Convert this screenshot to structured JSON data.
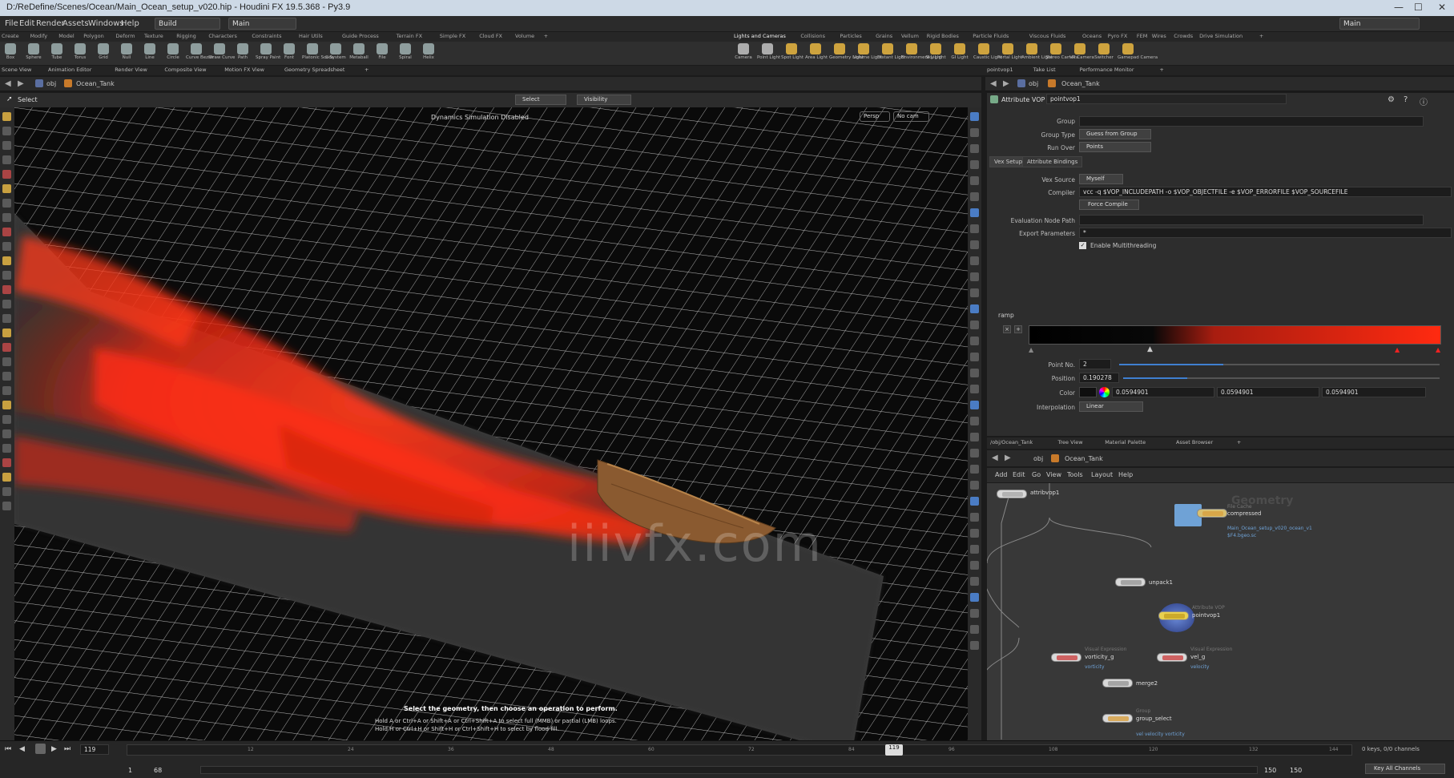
{
  "window": {
    "title": "D:/ReDefine/Scenes/Ocean/Main_Ocean_setup_v020.hip - Houdini FX 19.5.368 - Py3.9",
    "desktop_label": "Main",
    "controls": [
      "—",
      "☐",
      "✕"
    ]
  },
  "menubar": {
    "items": [
      "File",
      "Edit",
      "Render",
      "Assets",
      "Windows",
      "Help"
    ],
    "build_label": "Build",
    "main_label": "Main"
  },
  "shelf_tabs_left": [
    "Create",
    "Modify",
    "Model",
    "Polygon",
    "Deform",
    "Texture",
    "Rigging",
    "Characters",
    "Constraints",
    "Hair Utils",
    "Guide Process",
    "Terrain FX",
    "Simple FX",
    "Cloud FX",
    "Volume",
    "+"
  ],
  "shelf_tabs_right": [
    "Lights and Cameras",
    "Collisions",
    "Particles",
    "Grains",
    "Vellum",
    "Rigid Bodies",
    "Particle Fluids",
    "Viscous Fluids",
    "Oceans",
    "Pyro FX",
    "FEM",
    "Wires",
    "Crowds",
    "Drive Simulation",
    "+"
  ],
  "shelf_tools_left": [
    "Box",
    "Sphere",
    "Tube",
    "Torus",
    "Grid",
    "Null",
    "Line",
    "Circle",
    "Curve Bezier",
    "Draw Curve",
    "Path",
    "Spray Paint",
    "Font",
    "Platonic Solids",
    "L-System",
    "Metaball",
    "File",
    "Spiral",
    "Helix"
  ],
  "shelf_tools_right": [
    "Camera",
    "Point Light",
    "Spot Light",
    "Area Light",
    "Geometry Light",
    "Volume Light",
    "Distant Light",
    "Environment Light",
    "Sky Light",
    "GI Light",
    "Caustic Light",
    "Portal Light",
    "Ambient Light",
    "Stereo Camera",
    "VR Camera",
    "Switcher",
    "Gamepad Camera"
  ],
  "pane_tabs_left": [
    "Scene View",
    "Animation Editor",
    "Render View",
    "Composite View",
    "Motion FX View",
    "Geometry Spreadsheet",
    "+"
  ],
  "pane_tabs_right": [
    "pointvop1",
    "Take List",
    "Performance Monitor",
    "+"
  ],
  "viewport": {
    "path_root": "obj",
    "path_node": "Ocean_Tank",
    "tool_label": "Select",
    "select_dd": "Select",
    "visibility_dd": "Visibility",
    "status_top": "Dynamics Simulation Disabled",
    "persp": "Persp",
    "cam": "No cam",
    "hint_main": "Select the geometry, then choose an operation to perform.",
    "hint_1": "Hold A or Ctrl+A or Shift+A or Ctrl+Shift+A to select full (MMB) or partial (LMB) loops.",
    "hint_2": "Hold H or Ctrl+H or Shift+H or Ctrl+Shift+H to select by flood fill.",
    "watermark": "iiivfx.com"
  },
  "timeline": {
    "current_frame": "119",
    "start": "1",
    "end_field": "68",
    "range_end_a": "150",
    "range_end_b": "150",
    "marker": "119",
    "keys_info": "0 keys, 0/0 channels",
    "key_all": "Key All Channels",
    "ticks": [
      "12",
      "24",
      "36",
      "48",
      "60",
      "72",
      "84",
      "96",
      "108",
      "120",
      "132",
      "144"
    ]
  },
  "params": {
    "path_root": "obj",
    "path_node": "Ocean_Tank",
    "node_type": "Attribute VOP",
    "node_name": "pointvop1",
    "group_label": "Group",
    "group_value": "",
    "group_type_label": "Group Type",
    "group_type_value": "Guess from Group",
    "run_over_label": "Run Over",
    "run_over_value": "Points",
    "tab_vex": "Vex Setup",
    "tab_bind": "Attribute Bindings",
    "vex_source_label": "Vex Source",
    "vex_source_value": "Myself",
    "compiler_label": "Compiler",
    "compiler_value": "vcc -q $VOP_INCLUDEPATH -o $VOP_OBJECTFILE -e $VOP_ERRORFILE $VOP_SOURCEFILE",
    "force_compile": "Force Compile",
    "eval_path_label": "Evaluation Node Path",
    "eval_path_value": "",
    "export_label": "Export Parameters",
    "export_value": "*",
    "multithread_label": "Enable Multithreading",
    "ramp_label": "ramp",
    "point_no_label": "Point No.",
    "point_no_value": "2",
    "position_label": "Position",
    "position_value": "0.190278",
    "color_label": "Color",
    "color_r": "0.0594901",
    "color_g": "0.0594901",
    "color_b": "0.0594901",
    "interp_label": "Interpolation",
    "interp_value": "Linear"
  },
  "network": {
    "pane_tabs": [
      "/obj/Ocean_Tank",
      "Tree View",
      "Material Palette",
      "Asset Browser",
      "+"
    ],
    "path_root": "obj",
    "path_node": "Ocean_Tank",
    "menus": [
      "Add",
      "Edit",
      "Go",
      "View",
      "Tools",
      "Layout",
      "Help"
    ],
    "context_label": "Geometry",
    "nodes": {
      "attribvop1": "attribvop1",
      "compressed": "compressed",
      "compressed_type": "File Cache",
      "compressed_sub": "Main_Ocean_setup_v020_ocean_v1",
      "compressed_sub2": "$F4.bgeo.sc",
      "unpack": "unpack1",
      "pointvop_type": "Attribute VOP",
      "pointvop": "pointvop1",
      "vorticity_type": "Visual Expression",
      "vorticity": "vorticity_g",
      "vorticity_sub": "vorticity",
      "vel_type": "Visual Expression",
      "vel": "vel_g",
      "vel_sub": "velocity",
      "merge": "merge2",
      "group_type": "Group",
      "group": "group_select",
      "group_sub": "vel  velocity  vorticity"
    }
  },
  "colors": {
    "ramp_start": "#000000",
    "ramp_end": "#ff2a10",
    "accent": "#e84a1c"
  }
}
